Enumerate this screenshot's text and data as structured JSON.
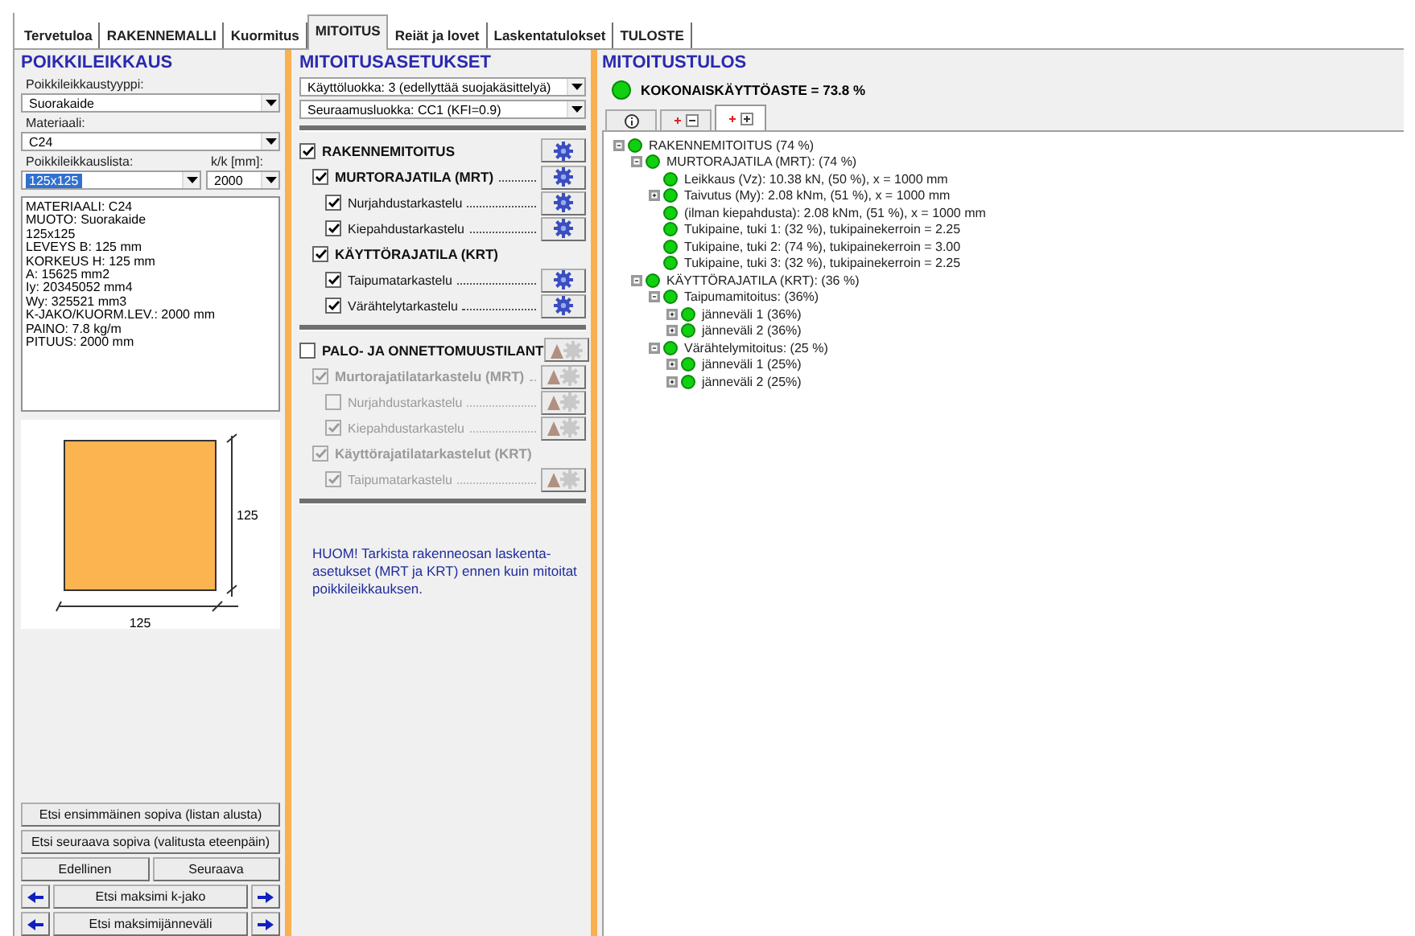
{
  "tabs": [
    {
      "label": "Tervetuloa",
      "selected": false
    },
    {
      "label": "RAKENNEMALLI",
      "selected": false
    },
    {
      "label": "Kuormitus",
      "selected": false
    },
    {
      "label": "MITOITUS",
      "selected": true
    },
    {
      "label": "Reiät ja lovet",
      "selected": false
    },
    {
      "label": "Laskentatulokset",
      "selected": false
    },
    {
      "label": "TULOSTE",
      "selected": false
    }
  ],
  "cross_section": {
    "title": "POIKKILEIKKAUS",
    "type_field": {
      "label": "Poikkileikkaustyyppi:",
      "value": "Suorakaide"
    },
    "material_field": {
      "label": "Materiaali:",
      "value": "C24"
    },
    "profile_field": {
      "label": "Poikkileikkauslista:",
      "value": "125x125",
      "focused": true
    },
    "spacing_field": {
      "label": "k/k [mm]:",
      "value": "2000",
      "focused": false
    },
    "properties": [
      "MATERIAALI: C24",
      "MUOTO: Suorakaide",
      "125x125",
      "LEVEYS B: 125 mm",
      "KORKEUS H: 125 mm",
      "A: 15625 mm2",
      "Iy: 20345052 mm4",
      "Wy: 325521 mm3",
      "K-JAKO/KUORM.LEV.: 2000 mm",
      "PAINO: 7.8 kg/m",
      "PITUUS: 2000 mm"
    ],
    "drawing": {
      "height_label": "125",
      "width_label": "125"
    },
    "buttons": [
      "Etsi ensimmäinen sopiva (listan alusta)",
      "Etsi seuraava sopiva (valitusta eteenpäin)"
    ],
    "nav_buttons": [
      "Edellinen",
      "Seuraava"
    ],
    "search_rows": [
      "Etsi maksimi k-jako",
      "Etsi maksimijänneväli"
    ]
  },
  "settings": {
    "title": "MITOITUSASETUKSET",
    "selects": [
      "Käyttöluokka: 3 (edellyttää suojakäsittelyä)",
      "Seuraamusluokka: CC1 (KFI=0.9)"
    ],
    "sections": [
      {
        "label": "RAKENNEMITOITUS",
        "checked": true,
        "disabled": false,
        "leader": false,
        "kind": "gear",
        "children": [
          {
            "label": "MURTORAJATILA (MRT)",
            "checked": true,
            "disabled": false,
            "leader": true,
            "kind": "gear",
            "children": [
              {
                "label": "Nurjahdustarkastelu",
                "checked": true,
                "disabled": false,
                "leader": true,
                "kind": "gear"
              },
              {
                "label": "Kiepahdustarkastelu",
                "checked": true,
                "disabled": false,
                "leader": true,
                "kind": "gear"
              }
            ]
          },
          {
            "label": "KÄYTTÖRAJATILA (KRT)",
            "checked": true,
            "disabled": false,
            "leader": false,
            "kind": "plain",
            "children": [
              {
                "label": "Taipumatarkastelu",
                "checked": true,
                "disabled": false,
                "leader": true,
                "kind": "gear"
              },
              {
                "label": "Värähtelytarkastelu",
                "checked": true,
                "disabled": false,
                "leader": true,
                "kind": "gear"
              }
            ]
          }
        ]
      },
      {
        "label": "PALO- JA ONNETTOMUUSTILANT",
        "checked": false,
        "disabled": false,
        "leader": false,
        "kind": "greyed_gear",
        "children": [
          {
            "label": "Murtorajatilatarkastelu (MRT)",
            "checked": true,
            "disabled": true,
            "leader": true,
            "kind": "greyed_gear",
            "children": [
              {
                "label": "Nurjahdustarkastelu",
                "checked": false,
                "disabled": true,
                "leader": true,
                "kind": "greyed_gear"
              },
              {
                "label": "Kiepahdustarkastelu",
                "checked": true,
                "disabled": true,
                "leader": true,
                "kind": "greyed_gear"
              }
            ]
          },
          {
            "label": "Käyttörajatilatarkastelut (KRT)",
            "checked": true,
            "disabled": true,
            "leader": false,
            "kind": "plain",
            "children": [
              {
                "label": "Taipumatarkastelu",
                "checked": true,
                "disabled": true,
                "leader": true,
                "kind": "greyed_gear"
              }
            ]
          }
        ]
      }
    ],
    "note": "HUOM! Tarkista rakenneosan laskenta-asetukset (MRT ja KRT) ennen kuin mitoitat poikkileikkauksen."
  },
  "result": {
    "title": "MITOITUSTULOS",
    "total": "KOKONAISKÄYTTÖASTE = 73.8 %",
    "toolbar": [
      {
        "kind": "info",
        "selected": false
      },
      {
        "kind": "collapse",
        "selected": false
      },
      {
        "kind": "expand",
        "selected": true
      }
    ],
    "tree": [
      {
        "label": "RAKENNEMITOITUS (74 %)",
        "kind": "open",
        "children": [
          {
            "label": "MURTORAJATILA (MRT): (74 %)",
            "kind": "open",
            "children": [
              {
                "label": "Leikkaus (Vz): 10.38 kN, (50 %), x = 1000 mm",
                "kind": "leaf"
              },
              {
                "label": "Taivutus (My): 2.08 kNm, (51 %), x = 1000 mm",
                "kind": "closed"
              },
              {
                "label": " (ilman kiepahdusta): 2.08 kNm, (51 %), x = 1000 mm",
                "kind": "leaf"
              },
              {
                "label": "Tukipaine, tuki 1: (32 %), tukipainekerroin = 2.25",
                "kind": "leaf"
              },
              {
                "label": "Tukipaine, tuki 2: (74 %), tukipainekerroin = 3.00",
                "kind": "leaf"
              },
              {
                "label": "Tukipaine, tuki 3: (32 %), tukipainekerroin = 2.25",
                "kind": "leaf"
              }
            ]
          },
          {
            "label": "KÄYTTÖRAJATILA (KRT): (36 %)",
            "kind": "open",
            "children": [
              {
                "label": "Taipumamitoitus: (36%)",
                "kind": "open",
                "children": [
                  {
                    "label": "jänneväli 1 (36%)",
                    "kind": "closed"
                  },
                  {
                    "label": "jänneväli 2 (36%)",
                    "kind": "closed"
                  }
                ]
              },
              {
                "label": "Värähtelymitoitus: (25 %)",
                "kind": "open",
                "children": [
                  {
                    "label": "jänneväli 1 (25%)",
                    "kind": "closed"
                  },
                  {
                    "label": "jänneväli 2 (25%)",
                    "kind": "closed"
                  }
                ]
              }
            ]
          }
        ]
      }
    ]
  }
}
